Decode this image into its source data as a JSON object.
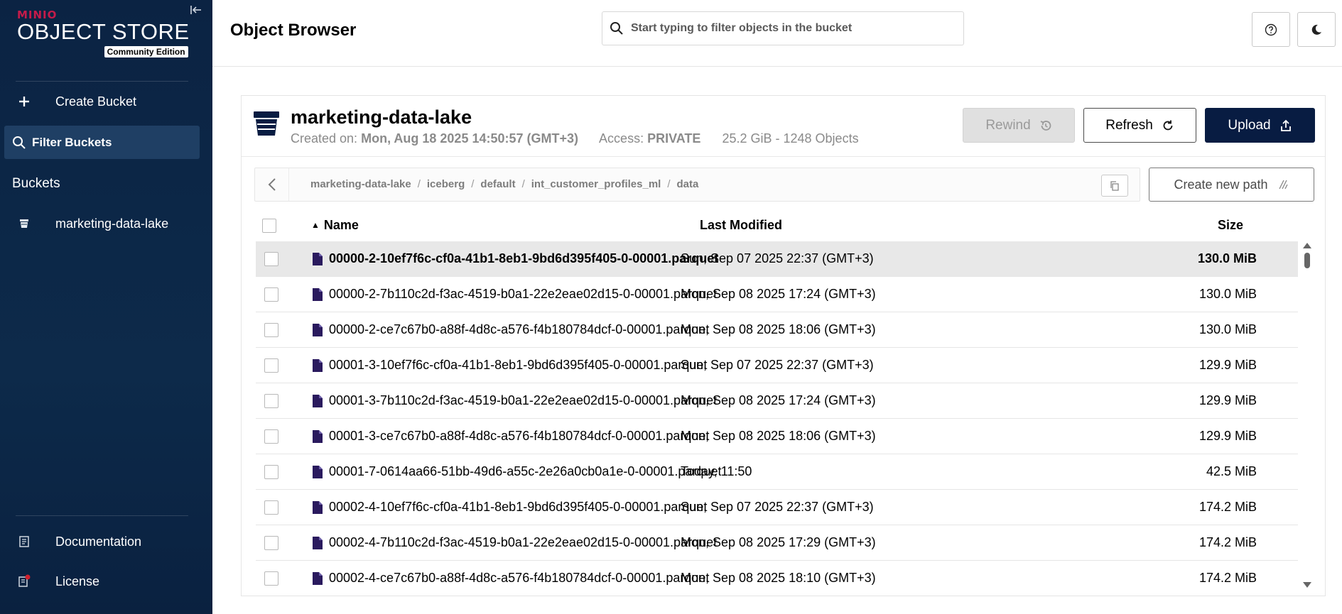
{
  "sidebar": {
    "logo_brand": "MINIO",
    "logo_title": "OBJECT STORE",
    "logo_edition": "Community Edition",
    "create_bucket_label": "Create Bucket",
    "filter_placeholder": "Filter Buckets",
    "buckets_title": "Buckets",
    "bucket_items": [
      {
        "label": "marketing-data-lake",
        "icon": "bucket-icon"
      }
    ],
    "documentation_label": "Documentation",
    "license_label": "License"
  },
  "header": {
    "title": "Object Browser",
    "search_placeholder": "Start typing to filter objects in the bucket",
    "help_icon": "help-icon",
    "theme_icon": "moon-icon"
  },
  "bucket": {
    "name": "marketing-data-lake",
    "created_label": "Created on:",
    "created_value": "Mon, Aug 18 2025 14:50:57 (GMT+3)",
    "access_label": "Access:",
    "access_value": "PRIVATE",
    "usage": "25.2 GiB - 1248 Objects",
    "rewind_label": "Rewind",
    "refresh_label": "Refresh",
    "upload_label": "Upload"
  },
  "breadcrumb": {
    "parts": [
      "marketing-data-lake",
      "iceberg",
      "default",
      "int_customer_profiles_ml",
      "data"
    ],
    "create_path_label": "Create new path"
  },
  "table": {
    "columns": {
      "name": "Name",
      "modified": "Last Modified",
      "size": "Size"
    },
    "sort_indicator": "▲",
    "rows": [
      {
        "name": "00000-2-10ef7f6c-cf0a-41b1-8eb1-9bd6d395f405-0-00001.parquet",
        "modified": "Sun, Sep 07 2025 22:37 (GMT+3)",
        "size": "130.0 MiB",
        "selected": true
      },
      {
        "name": "00000-2-7b110c2d-f3ac-4519-b0a1-22e2eae02d15-0-00001.parquet",
        "modified": "Mon, Sep 08 2025 17:24 (GMT+3)",
        "size": "130.0 MiB"
      },
      {
        "name": "00000-2-ce7c67b0-a88f-4d8c-a576-f4b180784dcf-0-00001.parquet",
        "modified": "Mon, Sep 08 2025 18:06 (GMT+3)",
        "size": "130.0 MiB"
      },
      {
        "name": "00001-3-10ef7f6c-cf0a-41b1-8eb1-9bd6d395f405-0-00001.parquet",
        "modified": "Sun, Sep 07 2025 22:37 (GMT+3)",
        "size": "129.9 MiB"
      },
      {
        "name": "00001-3-7b110c2d-f3ac-4519-b0a1-22e2eae02d15-0-00001.parquet",
        "modified": "Mon, Sep 08 2025 17:24 (GMT+3)",
        "size": "129.9 MiB"
      },
      {
        "name": "00001-3-ce7c67b0-a88f-4d8c-a576-f4b180784dcf-0-00001.parquet",
        "modified": "Mon, Sep 08 2025 18:06 (GMT+3)",
        "size": "129.9 MiB"
      },
      {
        "name": "00001-7-0614aa66-51bb-49d6-a55c-2e26a0cb0a1e-0-00001.parquet",
        "modified": "Today, 11:50",
        "size": "42.5 MiB"
      },
      {
        "name": "00002-4-10ef7f6c-cf0a-41b1-8eb1-9bd6d395f405-0-00001.parquet",
        "modified": "Sun, Sep 07 2025 22:37 (GMT+3)",
        "size": "174.2 MiB"
      },
      {
        "name": "00002-4-7b110c2d-f3ac-4519-b0a1-22e2eae02d15-0-00001.parquet",
        "modified": "Mon, Sep 08 2025 17:29 (GMT+3)",
        "size": "174.2 MiB"
      },
      {
        "name": "00002-4-ce7c67b0-a88f-4d8c-a576-f4b180784dcf-0-00001.parquet",
        "modified": "Mon, Sep 08 2025 18:10 (GMT+3)",
        "size": "174.2 MiB"
      }
    ]
  },
  "colors": {
    "sidebar": "#0b2343",
    "primary": "#081c42",
    "brand_red": "#c51b4a",
    "file_icon": "#2a1a5e"
  }
}
